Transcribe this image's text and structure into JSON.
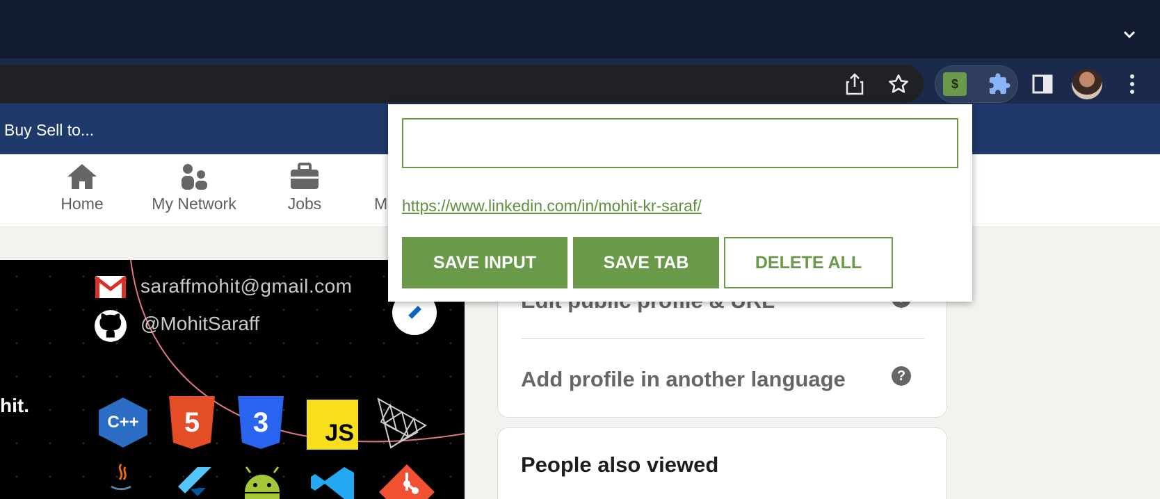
{
  "browser": {
    "bookmark_label": "Buy Sell to...",
    "extension_badge": "$"
  },
  "linkedin_nav": {
    "items": [
      {
        "label": "Home",
        "icon": "home-icon"
      },
      {
        "label": "My Network",
        "icon": "network-icon"
      },
      {
        "label": "Jobs",
        "icon": "briefcase-icon"
      },
      {
        "label": "M",
        "icon": "messaging-icon"
      }
    ]
  },
  "banner": {
    "email": "saraffmohit@gmail.com",
    "github": "@MohitSaraff",
    "name_fragment": "hit.",
    "tech_icons": [
      "C++",
      "5",
      "3",
      "JS"
    ]
  },
  "sidebar": {
    "public_profile_label": "Edit public profile & URL",
    "language_label": "Add profile in another language",
    "help_glyph": "?",
    "people_also_viewed_title": "People also viewed"
  },
  "popup": {
    "input_value": "",
    "saved_link": "https://www.linkedin.com/in/mohit-kr-saraf/",
    "save_input_label": "SAVE INPUT",
    "save_tab_label": "SAVE TAB",
    "delete_all_label": "DELETE ALL"
  },
  "colors": {
    "accent_green": "#6a9a49",
    "chrome_dark": "#121a31",
    "linkedin_bar": "#1f3a6a"
  }
}
